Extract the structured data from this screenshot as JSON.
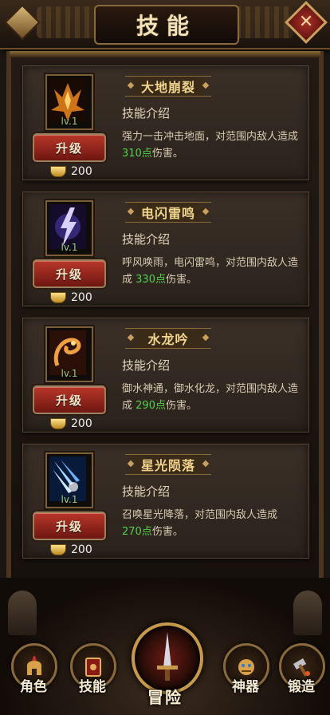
{
  "header": {
    "title": "技能",
    "back_icon": "diamond-back-icon",
    "close_icon": "close-x-icon",
    "close_symbol": "✕"
  },
  "skills": [
    {
      "name": "大地崩裂",
      "level": "lv.1",
      "upgrade_label": "升级",
      "cost": "200",
      "intro_title": "技能介绍",
      "desc_before": "强力一击冲击地面，对范围内敌人造成",
      "desc_value": "310点",
      "desc_after": "伤害。",
      "icon": "earth-crack-icon",
      "icon_color": "#e0801a"
    },
    {
      "name": "电闪雷鸣",
      "level": "lv.1",
      "upgrade_label": "升级",
      "cost": "200",
      "intro_title": "技能介绍",
      "desc_before": "呼风唤雨，电闪雷鸣，对范围内敌人造成",
      "desc_value": "330点",
      "desc_after": "伤害。",
      "icon": "lightning-icon",
      "icon_color": "#7a6ad8"
    },
    {
      "name": "水龙吟",
      "level": "lv.1",
      "upgrade_label": "升级",
      "cost": "200",
      "intro_title": "技能介绍",
      "desc_before": "御水神通，御水化龙，对范围内敌人造成",
      "desc_value": "290点",
      "desc_after": "伤害。",
      "icon": "water-dragon-icon",
      "icon_color": "#d06a20"
    },
    {
      "name": "星光陨落",
      "level": "lv.1",
      "upgrade_label": "升级",
      "cost": "200",
      "intro_title": "技能介绍",
      "desc_before": "召唤星光降落，对范围内敌人造成",
      "desc_value": "270点",
      "desc_after": "伤害。",
      "icon": "starfall-icon",
      "icon_color": "#3a8ae0"
    }
  ],
  "nav": {
    "role": "角色",
    "skill": "技能",
    "adventure": "冒险",
    "artifact": "神器",
    "forge": "锻造"
  },
  "colors": {
    "damage_value": "#4fd34a",
    "level_text": "#9ad07a",
    "upgrade_button": "#b8362a"
  }
}
